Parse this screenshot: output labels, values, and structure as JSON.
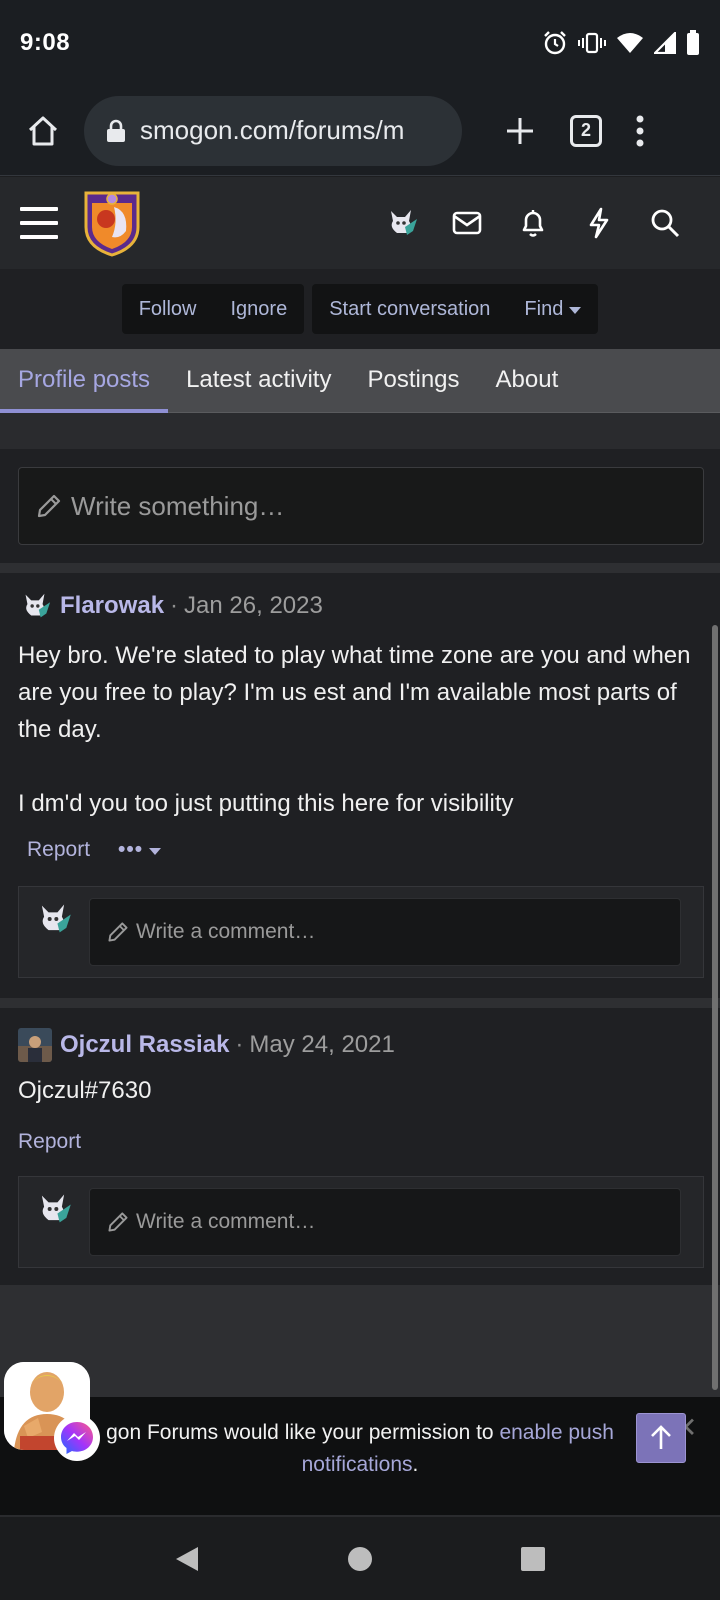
{
  "status_bar": {
    "time": "9:08",
    "icons": [
      "alarm-icon",
      "vibrate-icon",
      "wifi-icon",
      "signal-icon",
      "battery-icon"
    ]
  },
  "browser": {
    "url": "smogon.com/forums/m",
    "tab_count": "2"
  },
  "profile_actions": {
    "follow": "Follow",
    "ignore": "Ignore",
    "start_conversation": "Start conversation",
    "find": "Find"
  },
  "tabs": [
    {
      "label": "Profile posts",
      "active": true
    },
    {
      "label": "Latest activity",
      "active": false
    },
    {
      "label": "Postings",
      "active": false
    },
    {
      "label": "About",
      "active": false
    }
  ],
  "compose": {
    "placeholder": "Write something…"
  },
  "posts": [
    {
      "author": "Flarowak",
      "date": "Jan 26, 2023",
      "body": "Hey bro. We're slated to play what time zone are you and when are you free to play? I'm us est and I'm available most parts of the day.\n\nI dm'd you too just putting this here for visibility",
      "report": "Report",
      "comment_placeholder": "Write a comment…"
    },
    {
      "author": "Ojczul Rassiak",
      "date": "May 24, 2021",
      "body": "Ojczul#7630",
      "report": "Report",
      "comment_placeholder": "Write a comment…"
    }
  ],
  "push_banner": {
    "text_before": "gon Forums would like your permission to ",
    "link1": "enable push",
    "link2": "notifications",
    "text_after": "."
  },
  "colors": {
    "accent": "#8f90d4",
    "link": "#b2b3dc",
    "username": "#b9b8e8"
  }
}
